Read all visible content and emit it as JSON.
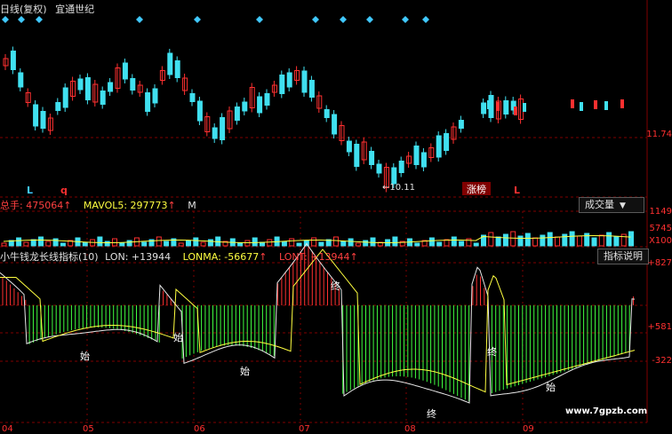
{
  "title": {
    "chart": "日线(复权)",
    "stock": "宜通世纪"
  },
  "volume": {
    "total_label": "总手: 475064",
    "mavol_label": "MAVOL5: 297773",
    "m_label": "M",
    "button_label": "成交量",
    "y_labels": [
      "1149",
      "5745",
      "X100"
    ]
  },
  "indicator": {
    "name": "小牛钱龙长线指标(10)",
    "lon": "LON: +13944",
    "lonma": "LONMA: -56677",
    "lont": "LONT: +13944",
    "help_button": "指标说明",
    "y_labels": [
      "+827",
      "+581",
      "-322"
    ],
    "markers": [
      "始",
      "终",
      "始",
      "终",
      "始",
      "终",
      "始"
    ]
  },
  "price": {
    "y_label": "11.74",
    "low_label": "10.11",
    "tag": "涨榜",
    "letters": [
      "L",
      "q",
      "L"
    ]
  },
  "x_labels": [
    "04",
    "05",
    "06",
    "07",
    "08",
    "09"
  ],
  "watermark": "www.7gpzb.com",
  "colors": {
    "up": "#ff3030",
    "down": "#40e0f0",
    "ma": "#ffff40",
    "grid": "#800000",
    "green": "#40ff40"
  }
}
